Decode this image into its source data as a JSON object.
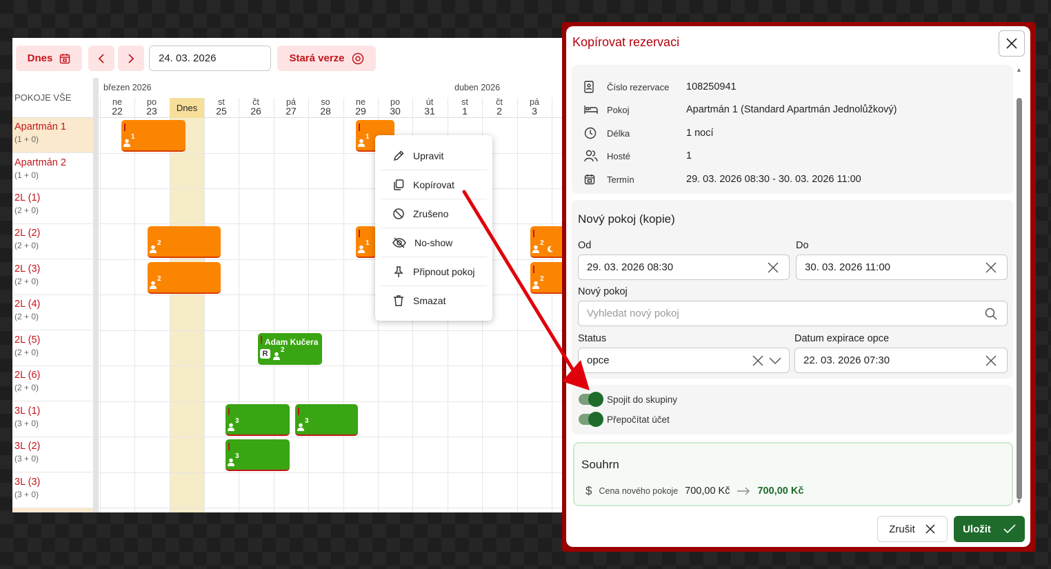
{
  "toolbar": {
    "today_label": "Dnes",
    "date_value": "24. 03. 2026",
    "old_version_label": "Stará verze"
  },
  "grid": {
    "rooms_header": "POKOJE VŠE",
    "month_march": "březen 2026",
    "month_april": "duben 2026",
    "today_label": "Dnes",
    "days": [
      {
        "name": "ne",
        "num": "22"
      },
      {
        "name": "po",
        "num": "23"
      },
      {
        "name": "",
        "num": ""
      },
      {
        "name": "st",
        "num": "25"
      },
      {
        "name": "čt",
        "num": "26"
      },
      {
        "name": "pá",
        "num": "27"
      },
      {
        "name": "so",
        "num": "28"
      },
      {
        "name": "ne",
        "num": "29"
      },
      {
        "name": "po",
        "num": "30"
      },
      {
        "name": "út",
        "num": "31"
      },
      {
        "name": "st",
        "num": "1"
      },
      {
        "name": "čt",
        "num": "2"
      },
      {
        "name": "pá",
        "num": "3"
      }
    ]
  },
  "rooms": [
    {
      "name": "Apartmán 1",
      "cap": "(1 + 0)"
    },
    {
      "name": "Apartmán 2",
      "cap": "(1 + 0)"
    },
    {
      "name": "2L (1)",
      "cap": "(2 + 0)"
    },
    {
      "name": "2L (2)",
      "cap": "(2 + 0)"
    },
    {
      "name": "2L (3)",
      "cap": "(2 + 0)"
    },
    {
      "name": "2L (4)",
      "cap": "(2 + 0)"
    },
    {
      "name": "2L (5)",
      "cap": "(2 + 0)"
    },
    {
      "name": "2L (6)",
      "cap": "(2 + 0)"
    },
    {
      "name": "3L (1)",
      "cap": "(3 + 0)"
    },
    {
      "name": "3L (2)",
      "cap": "(3 + 0)"
    },
    {
      "name": "3L (3)",
      "cap": "(3 + 0)"
    }
  ],
  "reservations": [
    {
      "guests": "1"
    },
    {
      "guests": "1"
    },
    {
      "guests": "2"
    },
    {
      "guests": "1"
    },
    {
      "guests": "2"
    },
    {
      "guests": "2"
    },
    {
      "guests": "2"
    },
    {
      "name": "Adam Kučera",
      "badge": "R",
      "guests": "2"
    },
    {
      "guests": "3"
    },
    {
      "guests": "3"
    },
    {
      "guests": "3"
    }
  ],
  "context_menu": {
    "edit": "Upravit",
    "copy": "Kopírovat",
    "cancelled": "Zrušeno",
    "no_show": "No-show",
    "pin_room": "Připnout pokoj",
    "delete": "Smazat"
  },
  "dialog": {
    "title": "Kopírovat rezervaci",
    "info": {
      "reservation_number_label": "Číslo rezervace",
      "reservation_number": "108250941",
      "room_label": "Pokoj",
      "room": "Apartmán 1 (Standard Apartmán Jednolůžkový)",
      "length_label": "Délka",
      "length": "1 nocí",
      "guests_label": "Hosté",
      "guests": "1",
      "term_label": "Termín",
      "term": "29. 03. 2026 08:30 - 30. 03. 2026 11:00"
    },
    "new_room_section": "Nový pokoj (kopie)",
    "from_label": "Od",
    "from_value": "29. 03. 2026 08:30",
    "to_label": "Do",
    "to_value": "30. 03. 2026 11:00",
    "new_room_label": "Nový pokoj",
    "new_room_placeholder": "Vyhledat nový pokoj",
    "status_label": "Status",
    "status_value": "opce",
    "option_expiry_label": "Datum expirace opce",
    "option_expiry_value": "22. 03. 2026 07:30",
    "toggle_group": "Spojit do skupiny",
    "toggle_recalc": "Přepočítat účet",
    "summary_title": "Souhrn",
    "summary_price_label": "Cena nového pokoje",
    "summary_old_price": "700,00 Kč",
    "summary_new_price": "700,00 Kč",
    "cancel_label": "Zrušit",
    "save_label": "Uložit"
  },
  "colors": {
    "brand_red": "#c3161c",
    "reservation_orange": "#fb8500",
    "reservation_green": "#3aa513",
    "save_green": "#1e6b2c",
    "today_highlight": "#f6df9a",
    "annotation_arrow": "#e0000b"
  }
}
